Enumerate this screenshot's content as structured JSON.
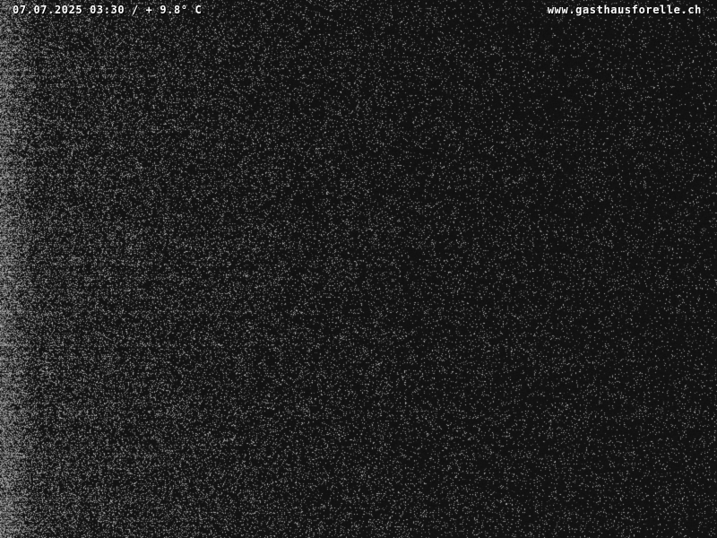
{
  "webcam": {
    "timestamp_text": "07.07.2025 03:30 / + 9.8° C",
    "site_text": "www.gasthausforelle.ch"
  },
  "colors": {
    "background": "#121212",
    "overlay_text": "#ffffff"
  }
}
